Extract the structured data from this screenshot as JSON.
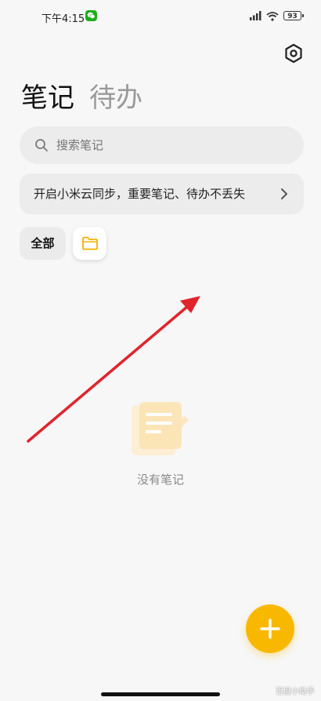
{
  "status_bar": {
    "time": "下午4:15",
    "battery": "93",
    "wechat_icon": "wechat-icon",
    "signal_icon": "signal-icon",
    "wifi_icon": "wifi-icon"
  },
  "header": {
    "settings_icon": "gear-icon",
    "tabs": [
      {
        "label": "笔记",
        "active": true
      },
      {
        "label": "待办",
        "active": false
      }
    ]
  },
  "search": {
    "placeholder": "搜索笔记",
    "value": ""
  },
  "sync_banner": {
    "text": "开启小米云同步，重要笔记、待办不丢失"
  },
  "folders": {
    "items": [
      {
        "label": "全部",
        "selected": false
      },
      {
        "icon": "folder-icon",
        "selected": true
      }
    ]
  },
  "empty_state": {
    "message": "没有笔记",
    "icon": "note-illustration-icon"
  },
  "fab": {
    "icon": "plus-icon"
  },
  "watermark": "百度小助手",
  "colors": {
    "accent": "#f9b800",
    "folder": "#f0b400",
    "annotation": "#e0242b",
    "background": "#f7f7f7",
    "card": "#ececec"
  }
}
